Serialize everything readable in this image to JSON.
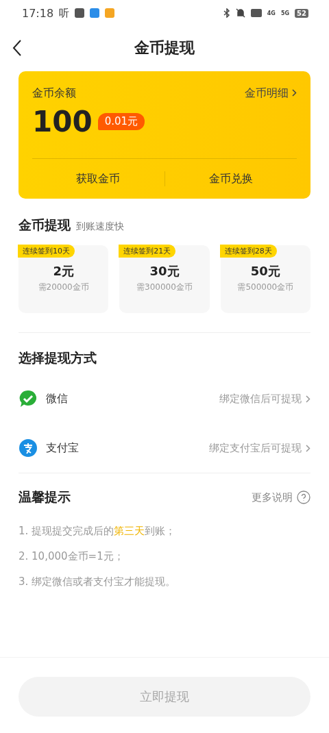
{
  "status_bar": {
    "time": "17:18",
    "app_glyph": "听",
    "network": [
      "4G",
      "5G"
    ],
    "battery": "52"
  },
  "header": {
    "title": "金币提现"
  },
  "balance_card": {
    "label": "金币余额",
    "detail_link": "金币明细",
    "amount": "100",
    "value_badge": "0.01元",
    "actions": [
      "获取金币",
      "金币兑换"
    ]
  },
  "withdraw": {
    "title": "金币提现",
    "subtitle": "到账速度快",
    "options": [
      {
        "tag": "连续签到10天",
        "amount": "2元",
        "cost": "需20000金币"
      },
      {
        "tag": "连续签到21天",
        "amount": "30元",
        "cost": "需300000金币"
      },
      {
        "tag": "连续签到28天",
        "amount": "50元",
        "cost": "需500000金币"
      }
    ]
  },
  "methods": {
    "title": "选择提现方式",
    "items": [
      {
        "kind": "wechat",
        "name": "微信",
        "hint": "绑定微信后可提现"
      },
      {
        "kind": "alipay",
        "name": "支付宝",
        "hint": "绑定支付宝后可提现"
      }
    ]
  },
  "tips": {
    "title": "温馨提示",
    "more": "更多说明",
    "items": [
      "1. 提现提交完成后的**第三天**到账；",
      "2. 10,000金币=1元；",
      "3. 绑定微信或者支付宝才能提现。"
    ]
  },
  "submit": {
    "label": "立即提现",
    "disabled": true
  }
}
